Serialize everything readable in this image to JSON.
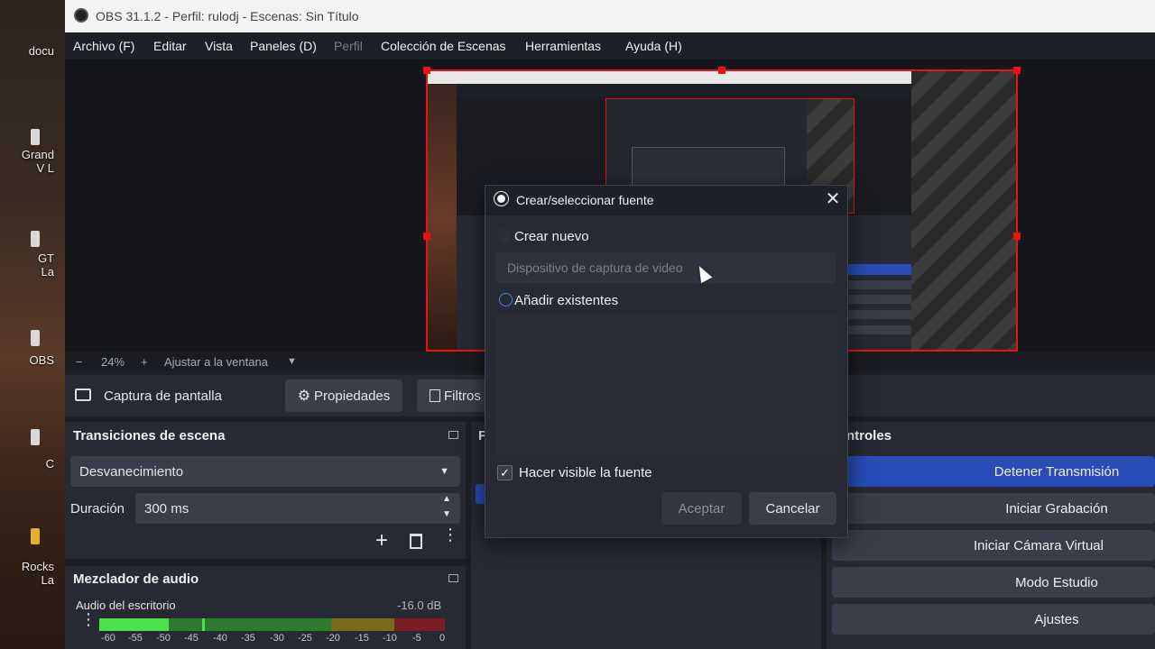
{
  "window": {
    "title": "OBS 31.1.2 - Perfil: rulodj - Escenas: Sin Título"
  },
  "desktop": {
    "labels": [
      "docu",
      "Grand\nV L",
      "GT\nLa",
      "OBS",
      "C",
      "Rocks\nLa"
    ]
  },
  "menu": {
    "items": [
      "Archivo (F)",
      "Editar",
      "Vista",
      "Paneles (D)",
      "Perfil",
      "Colección de Escenas",
      "Herramientas",
      "Ayuda (H)"
    ]
  },
  "zoom": {
    "minus": "−",
    "percent": "24%",
    "plus": "+",
    "fit_label": "Ajustar a la ventana",
    "dropdown": "▼"
  },
  "source_toolbar": {
    "source_name": "Captura de pantalla",
    "properties_label": "Propiedades",
    "filters_label": "Filtros"
  },
  "transitions": {
    "title": "Transiciones de escena",
    "selected": "Desvanecimiento",
    "duration_label": "Duración",
    "duration_value": "300 ms"
  },
  "mixer": {
    "title": "Mezclador de audio",
    "channel_name": "Audio del escritorio",
    "level": "-16.0 dB",
    "ticks": [
      "-60",
      "-55",
      "-50",
      "-45",
      "-40",
      "-35",
      "-30",
      "-25",
      "-20",
      "-15",
      "-10",
      "-5",
      "0"
    ]
  },
  "controls": {
    "title": "ntroles",
    "buttons": [
      "Detener Transmisión",
      "Iniciar Grabación",
      "Iniciar Cámara Virtual",
      "Modo Estudio",
      "Ajustes"
    ]
  },
  "middle_dock": {
    "title_fragment": "F"
  },
  "dialog": {
    "title": "Crear/seleccionar fuente",
    "close": "✕",
    "create_new_label": "Crear nuevo",
    "new_name_value": "Dispositivo de captura de video",
    "add_existing_label": "Añadir existentes",
    "make_visible_label": "Hacer visible la fuente",
    "make_visible_checked": true,
    "accept_label": "Aceptar",
    "cancel_label": "Cancelar"
  },
  "colors": {
    "accent": "#284cb8",
    "selection_border": "#ee1111",
    "window_bg": "#1d1f26",
    "dock_bg": "#272a33",
    "button_bg": "#3a3e4b"
  }
}
